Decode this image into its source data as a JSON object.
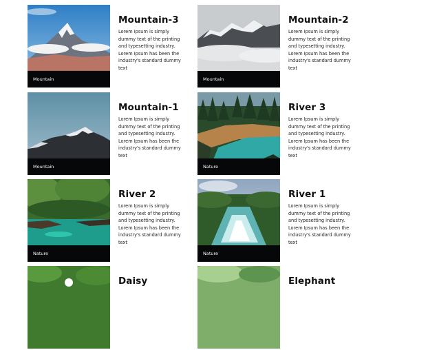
{
  "cards": [
    {
      "title": "Mountain-3",
      "tag": "Mountain",
      "desc": "Lorem Ipsum is simply dummy text of the printing and typesetting industry. Lorem Ipsum has been the industry's standard dummy text"
    },
    {
      "title": "Mountain-2",
      "tag": "Mountain",
      "desc": "Lorem Ipsum is simply dummy text of the printing and typesetting industry. Lorem Ipsum has been the industry's standard dummy text"
    },
    {
      "title": "Mountain-1",
      "tag": "Mountain",
      "desc": "Lorem Ipsum is simply dummy text of the printing and typesetting industry. Lorem Ipsum has been the industry's standard dummy text"
    },
    {
      "title": "River 3",
      "tag": "Nature",
      "desc": "Lorem Ipsum is simply dummy text of the printing and typesetting industry. Lorem Ipsum has been the industry's standard dummy text"
    },
    {
      "title": "River 2",
      "tag": "Nature",
      "desc": "Lorem Ipsum is simply dummy text of the printing and typesetting industry. Lorem Ipsum has been the industry's standard dummy text"
    },
    {
      "title": "River 1",
      "tag": "Nature",
      "desc": "Lorem Ipsum is simply dummy text of the printing and typesetting industry. Lorem Ipsum has been the industry's standard dummy text"
    },
    {
      "title": "Daisy",
      "tag": "",
      "desc": ""
    },
    {
      "title": "Elephant",
      "tag": "",
      "desc": ""
    }
  ]
}
